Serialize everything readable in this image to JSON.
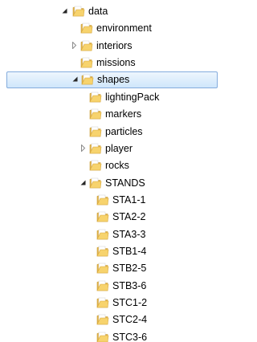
{
  "tree": {
    "items": [
      {
        "label": "data",
        "state": "expanded",
        "selected": false,
        "level": 0
      },
      {
        "label": "environment",
        "state": "leaf",
        "selected": false,
        "level": 1
      },
      {
        "label": "interiors",
        "state": "collapsed",
        "selected": false,
        "level": 1
      },
      {
        "label": "missions",
        "state": "leaf",
        "selected": false,
        "level": 1
      },
      {
        "label": "shapes",
        "state": "expanded",
        "selected": true,
        "level": 1
      },
      {
        "label": "lightingPack",
        "state": "leaf",
        "selected": false,
        "level": 2
      },
      {
        "label": "markers",
        "state": "leaf",
        "selected": false,
        "level": 2
      },
      {
        "label": "particles",
        "state": "leaf",
        "selected": false,
        "level": 2
      },
      {
        "label": "player",
        "state": "collapsed",
        "selected": false,
        "level": 2
      },
      {
        "label": "rocks",
        "state": "leaf",
        "selected": false,
        "level": 2
      },
      {
        "label": "STANDS",
        "state": "expanded",
        "selected": false,
        "level": 2
      },
      {
        "label": "STA1-1",
        "state": "leaf",
        "selected": false,
        "level": 3
      },
      {
        "label": "STA2-2",
        "state": "leaf",
        "selected": false,
        "level": 3
      },
      {
        "label": "STA3-3",
        "state": "leaf",
        "selected": false,
        "level": 3
      },
      {
        "label": "STB1-4",
        "state": "leaf",
        "selected": false,
        "level": 3
      },
      {
        "label": "STB2-5",
        "state": "leaf",
        "selected": false,
        "level": 3
      },
      {
        "label": "STB3-6",
        "state": "leaf",
        "selected": false,
        "level": 3
      },
      {
        "label": "STC1-2",
        "state": "leaf",
        "selected": false,
        "level": 3
      },
      {
        "label": "STC2-4",
        "state": "leaf",
        "selected": false,
        "level": 3
      },
      {
        "label": "STC3-6",
        "state": "leaf",
        "selected": false,
        "level": 3
      }
    ]
  },
  "icons": {
    "folder": "folder-icon",
    "expanded": "expanded-arrow-icon",
    "collapsed": "collapsed-arrow-icon"
  },
  "colors": {
    "folder_front": "#f7d36d",
    "folder_back": "#e6b64a",
    "selection_border": "#84acdd",
    "selection_fill": "#cfe6fb"
  }
}
